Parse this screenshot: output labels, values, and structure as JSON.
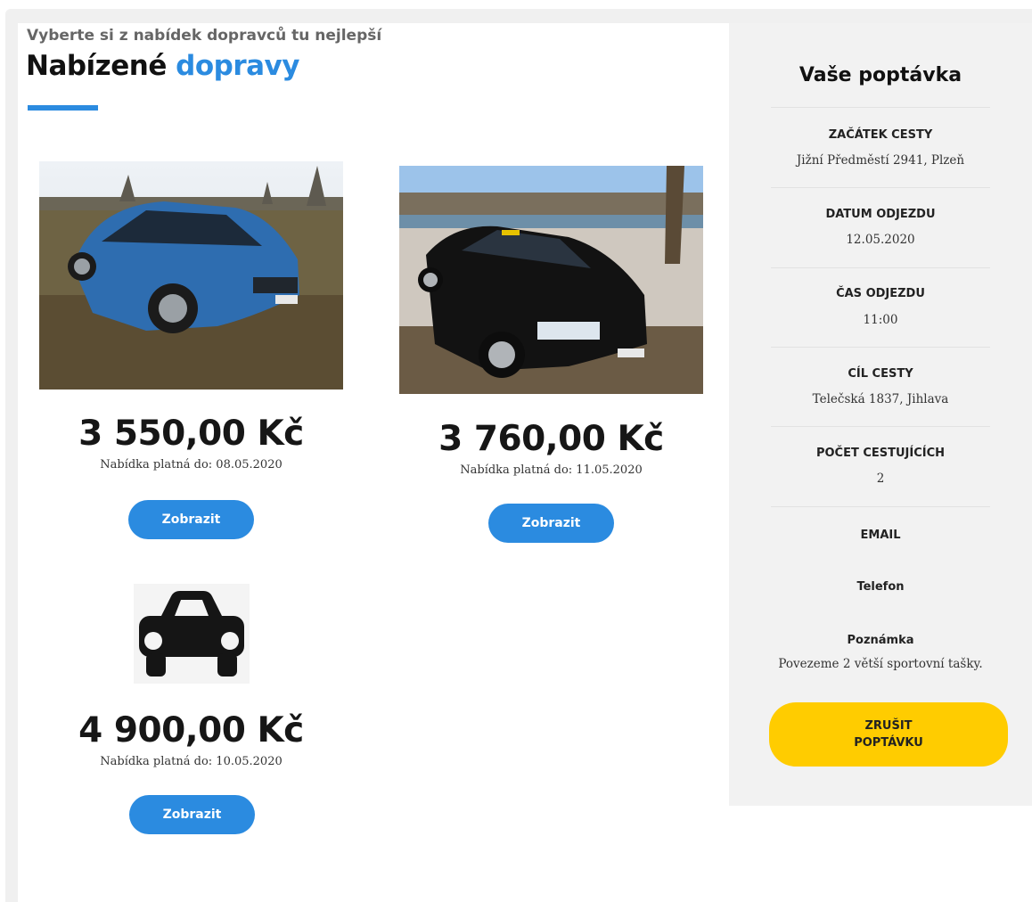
{
  "header": {
    "subtitle": "Vyberte si z nabídek dopravců tu nejlepší",
    "title_main": "Nabízené",
    "title_accent": "dopravy"
  },
  "offers": [
    {
      "price": "3 550,00 Kč",
      "valid": "Nabídka platná do: 08.05.2020",
      "button": "Zobrazit",
      "image": "blue-station-wagon-photo"
    },
    {
      "price": "3 760,00 Kč",
      "valid": "Nabídka platná do: 11.05.2020",
      "button": "Zobrazit",
      "image": "black-taxi-car-photo"
    },
    {
      "price": "4 900,00 Kč",
      "valid": "Nabídka platná do: 10.05.2020",
      "button": "Zobrazit",
      "image": "car-icon"
    }
  ],
  "sidebar": {
    "title": "Vaše poptávka",
    "fields": [
      {
        "label": "ZAČÁTEK CESTY",
        "value": "Jižní Předměstí 2941, Plzeň"
      },
      {
        "label": "DATUM ODJEZDU",
        "value": "12.05.2020"
      },
      {
        "label": "ČAS ODJEZDU",
        "value": "11:00"
      },
      {
        "label": "CÍL CESTY",
        "value": "Telečská 1837, Jihlava"
      },
      {
        "label": "POČET CESTUJÍCÍCH",
        "value": "2"
      },
      {
        "label": "EMAIL",
        "value": ""
      },
      {
        "label": "Telefon",
        "value": ""
      },
      {
        "label": "Poznámka",
        "value": "Povezeme 2 větší sportovní tašky."
      }
    ],
    "cancel_line1": "ZRUŠIT",
    "cancel_line2": "POPTÁVKU"
  },
  "colors": {
    "accent": "#2b8be0",
    "cancel": "#ffcc00",
    "sidebar_bg": "#f2f2f2"
  }
}
